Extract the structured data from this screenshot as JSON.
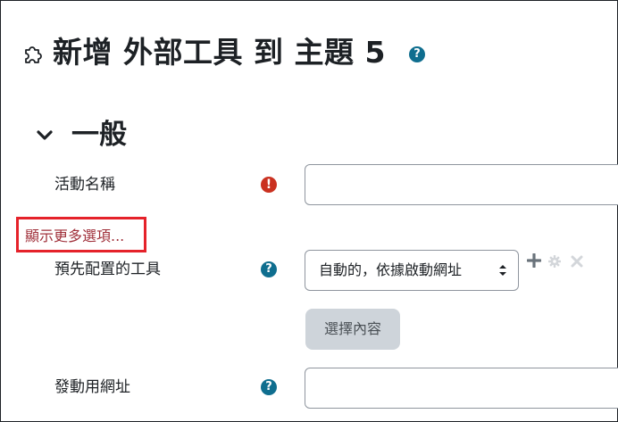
{
  "page": {
    "title": "新增 外部工具 到 主題 5",
    "title_icon": "puzzle-piece-icon",
    "help_icon": "question-circle-icon"
  },
  "section": {
    "title": "一般",
    "toggle_icon": "chevron-down-icon"
  },
  "form": {
    "activity_name": {
      "label": "活動名稱",
      "required_icon": "exclamation-circle-icon",
      "value": ""
    },
    "show_more_link": "顯示更多選項...",
    "preconfigured_tool": {
      "label": "預先配置的工具",
      "selected": "自動的，依據啟動網址",
      "actions": [
        "plus-icon",
        "gear-icon",
        "close-icon"
      ]
    },
    "select_content_button": "選擇內容",
    "launch_url": {
      "label": "發動用網址",
      "value": ""
    }
  },
  "colors": {
    "help_icon": "#0f6e8f",
    "required_icon": "#ca3120",
    "link": "#a0303a",
    "highlight_border": "#e5222a",
    "disabled_button": "#ced4da"
  }
}
